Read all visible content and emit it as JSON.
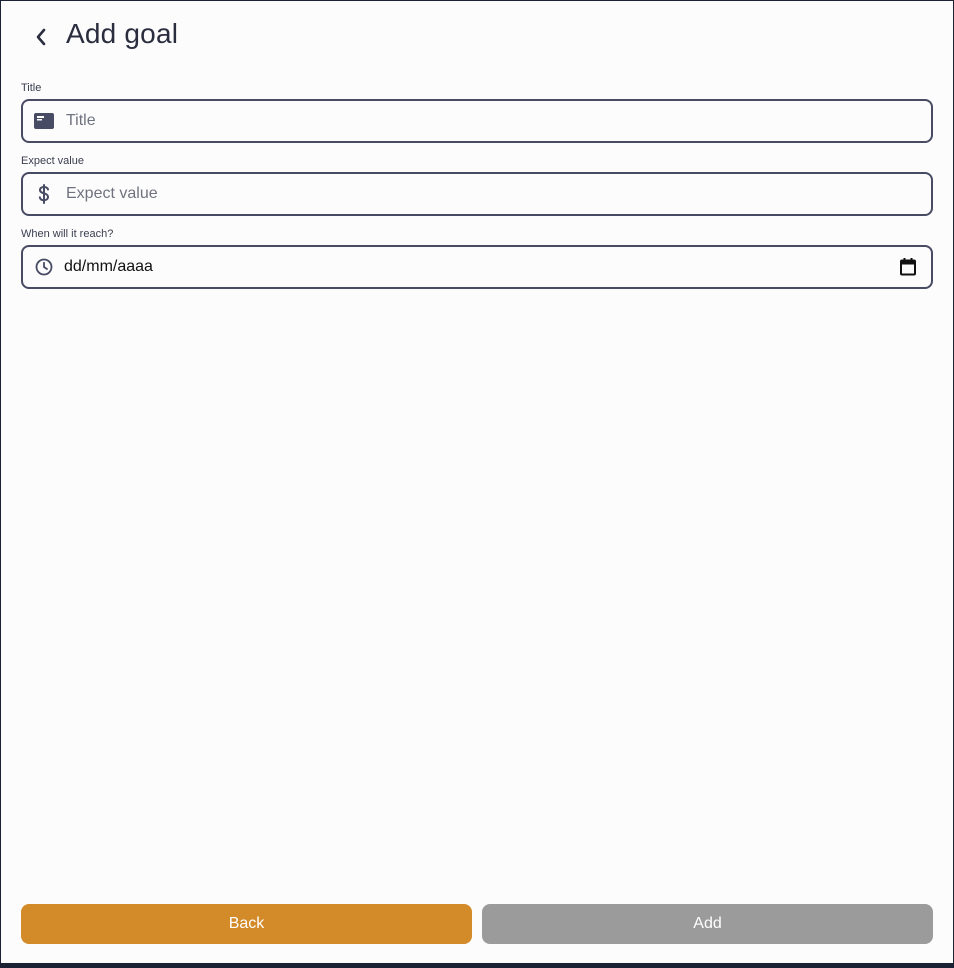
{
  "header": {
    "title": "Add goal",
    "back_icon": "chevron-left-icon"
  },
  "form": {
    "title_field": {
      "label": "Title",
      "placeholder": "Title",
      "value": "",
      "icon": "card-icon"
    },
    "expect_value_field": {
      "label": "Expect value",
      "placeholder": "Expect value",
      "value": "",
      "icon": "dollar-icon"
    },
    "date_field": {
      "label": "When will it reach?",
      "value": "dd/mm/aaaa",
      "icon": "clock-icon",
      "picker_icon": "calendar-icon"
    }
  },
  "actions": {
    "back_label": "Back",
    "add_label": "Add"
  },
  "colors": {
    "back_button": "#d38a28",
    "add_button_disabled": "#9b9b9b",
    "field_border": "#474b63",
    "background": "#fcfcfd"
  }
}
